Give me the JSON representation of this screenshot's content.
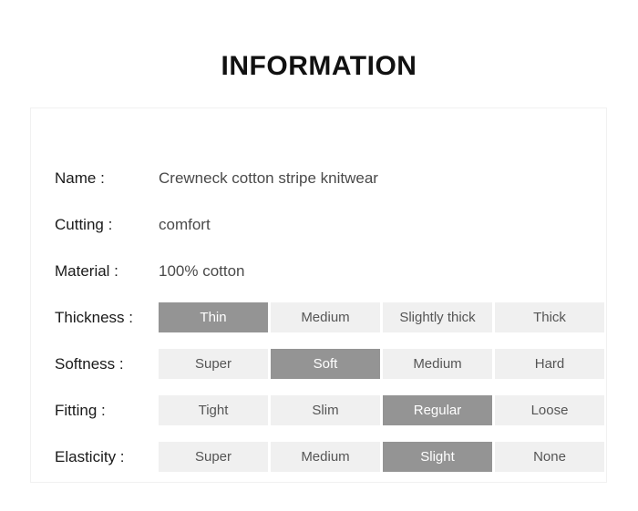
{
  "page": {
    "title": "INFORMATION"
  },
  "colors": {
    "selected_bg": "#949494",
    "selected_text": "#ffffff",
    "option_bg": "#f0f0f0",
    "option_text": "#555555",
    "card_border": "#f1f1f1",
    "label_text": "#1a1a1a",
    "value_text": "#4a4a4a"
  },
  "text_rows": [
    {
      "label": "Name :",
      "value": "Crewneck cotton stripe knitwear"
    },
    {
      "label": "Cutting :",
      "value": "comfort"
    },
    {
      "label": "Material :",
      "value": "100% cotton"
    }
  ],
  "option_rows": [
    {
      "label": "Thickness :",
      "options": [
        {
          "label": "Thin",
          "selected": true
        },
        {
          "label": "Medium",
          "selected": false
        },
        {
          "label": "Slightly thick",
          "selected": false
        },
        {
          "label": "Thick",
          "selected": false
        }
      ]
    },
    {
      "label": "Softness :",
      "options": [
        {
          "label": "Super",
          "selected": false
        },
        {
          "label": "Soft",
          "selected": true
        },
        {
          "label": "Medium",
          "selected": false
        },
        {
          "label": "Hard",
          "selected": false
        }
      ]
    },
    {
      "label": "Fitting :",
      "options": [
        {
          "label": "Tight",
          "selected": false
        },
        {
          "label": "Slim",
          "selected": false
        },
        {
          "label": "Regular",
          "selected": true
        },
        {
          "label": "Loose",
          "selected": false
        }
      ]
    },
    {
      "label": "Elasticity :",
      "options": [
        {
          "label": "Super",
          "selected": false
        },
        {
          "label": "Medium",
          "selected": false
        },
        {
          "label": "Slight",
          "selected": true
        },
        {
          "label": "None",
          "selected": false
        }
      ]
    }
  ]
}
